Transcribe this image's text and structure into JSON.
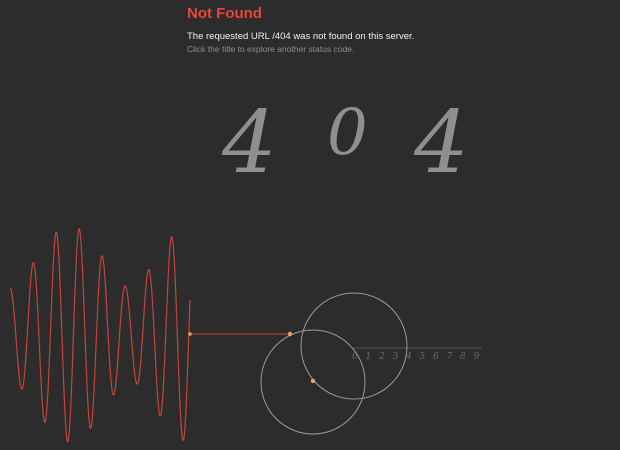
{
  "header": {
    "title": "Not Found",
    "message": "The requested URL /404 was not found on this server.",
    "hint": "Click the title to explore another status code."
  },
  "status_code": {
    "digits": [
      "4",
      "0",
      "4"
    ]
  },
  "scale": {
    "digits": [
      "0",
      "1",
      "2",
      "3",
      "4",
      "5",
      "6",
      "7",
      "8",
      "9"
    ]
  },
  "colors": {
    "background": "#2c2c2c",
    "accent": "#e8473a",
    "wave": "#c4453a",
    "digits": "#8f8f8f",
    "circles": "#9b9b9b",
    "handle": "#f0a06a"
  }
}
